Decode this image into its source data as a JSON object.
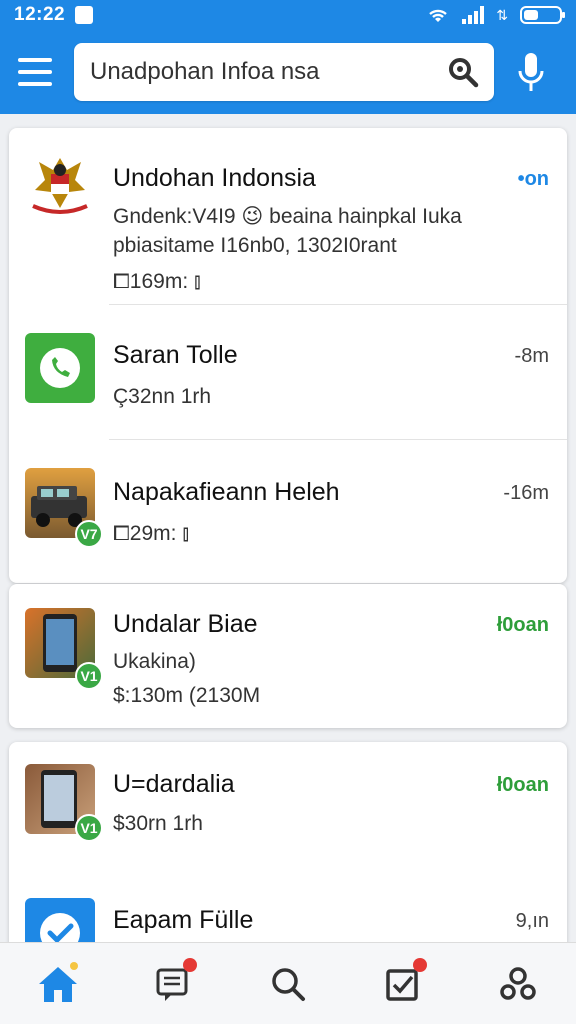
{
  "status_bar": {
    "time": "12:22"
  },
  "header": {
    "search_value": "Unadpohan Infoa nsa"
  },
  "list": [
    {
      "title": "Undohan Indonsia",
      "line1": "Gndenk:V4I9 😉 beaina hainpkal Iuka",
      "line2": "pbiasitame I16nb0, 1302I0rant",
      "line3": "⧠169m: ⫾",
      "time": "•on",
      "time_color": "#1e88e5"
    },
    {
      "title": "Saran Tolle",
      "line1": "Ç32nn 1rh",
      "time": "-8m"
    },
    {
      "title": "Napakafieann Heleh",
      "line1": "⧠29m: ⫾",
      "time": "-16m",
      "badge": "V7"
    },
    {
      "title": "Undalar Biae",
      "line1": "Ukakina)",
      "line2": "$:130m (2130M",
      "time": "ł0oan",
      "time_color": "#2e9e3a",
      "badge": "V1"
    },
    {
      "title": "U=dardalia",
      "line1": "$30rn 1rh",
      "time": "ł0oan",
      "time_color": "#2e9e3a",
      "badge": "V1"
    },
    {
      "title": "Eapam Fülle",
      "time": "9,ın"
    }
  ],
  "bottom_nav": {
    "items": [
      "home-icon",
      "chat-icon",
      "search-icon",
      "tasks-icon",
      "profile-icon"
    ],
    "badge_color": "#e53935"
  },
  "colors": {
    "primary": "#1e88e5",
    "verified_green": "#3aa845"
  }
}
